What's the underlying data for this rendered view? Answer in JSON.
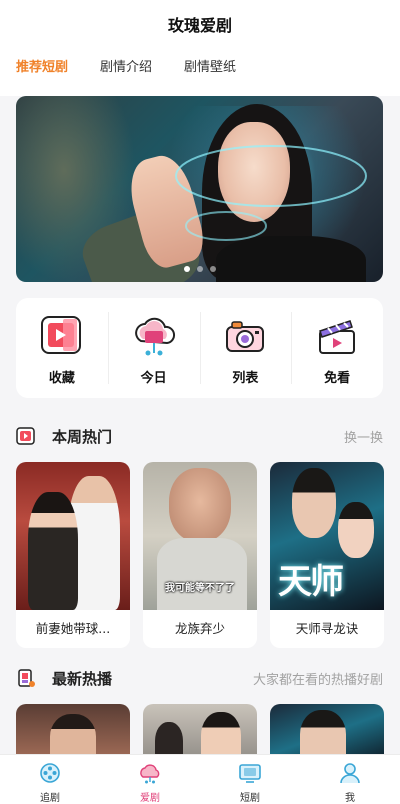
{
  "header": {
    "title": "玫瑰爱剧",
    "tabs": [
      {
        "label": "推荐短剧",
        "active": true
      },
      {
        "label": "剧情介绍",
        "active": false
      },
      {
        "label": "剧情壁纸",
        "active": false
      }
    ]
  },
  "banner": {
    "page_count": 3,
    "active_index": 0
  },
  "quick_actions": [
    {
      "label": "收藏",
      "icon": "collection-icon"
    },
    {
      "label": "今日",
      "icon": "cloud-today-icon"
    },
    {
      "label": "列表",
      "icon": "camera-list-icon"
    },
    {
      "label": "免看",
      "icon": "clapperboard-icon"
    }
  ],
  "weekly_hot": {
    "title": "本周热门",
    "more_label": "换一换",
    "items": [
      {
        "title": "前妻她带球..."
      },
      {
        "title": "龙族弃少",
        "caption": "我可能等不了了"
      },
      {
        "title": "天师寻龙诀",
        "poster_text": "天师"
      }
    ]
  },
  "latest": {
    "title": "最新热播",
    "subtitle": "大家都在看的热播好剧"
  },
  "tabbar": {
    "items": [
      {
        "label": "追剧",
        "icon": "film-reel-icon",
        "active": false
      },
      {
        "label": "爱剧",
        "icon": "heart-cloud-icon",
        "active": true
      },
      {
        "label": "短剧",
        "icon": "tv-screen-icon",
        "active": false
      },
      {
        "label": "我",
        "icon": "user-icon",
        "active": false
      }
    ]
  },
  "colors": {
    "accent": "#f0822a",
    "tab_active": "#e0427a",
    "muted": "#a2a2a2"
  }
}
